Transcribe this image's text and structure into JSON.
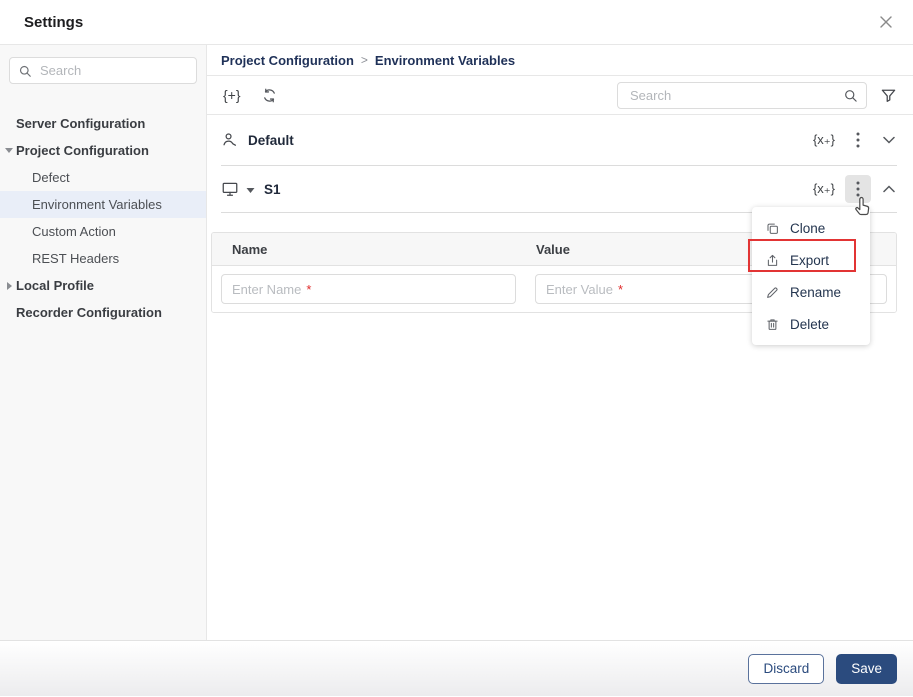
{
  "window": {
    "title": "Settings"
  },
  "sidebar": {
    "search": {
      "placeholder": "Search"
    },
    "items": [
      {
        "label": "Server Configuration"
      },
      {
        "label": "Project Configuration"
      },
      {
        "label": "Defect"
      },
      {
        "label": "Environment Variables"
      },
      {
        "label": "Custom Action"
      },
      {
        "label": "REST Headers"
      },
      {
        "label": "Local Profile"
      },
      {
        "label": "Recorder Configuration"
      }
    ]
  },
  "main": {
    "breadcrumb": {
      "parent": "Project Configuration",
      "separator": ">",
      "current": "Environment Variables"
    },
    "toolbar": {
      "add_glyph": "{+}",
      "search_placeholder": "Search"
    },
    "sections": {
      "default": {
        "label": "Default",
        "add_variable_glyph": "{x₊}"
      },
      "s1": {
        "label": "S1",
        "add_variable_glyph": "{x₊}"
      }
    },
    "table": {
      "columns": [
        "Name",
        "Value"
      ],
      "name_input": {
        "placeholder": "Enter Name",
        "required_mark": "*"
      },
      "value_input": {
        "placeholder": "Enter Value",
        "required_mark": "*"
      }
    },
    "context_menu": {
      "items": [
        {
          "label": "Clone"
        },
        {
          "label": "Export"
        },
        {
          "label": "Rename"
        },
        {
          "label": "Delete"
        }
      ]
    }
  },
  "footer": {
    "discard_label": "Discard",
    "save_label": "Save"
  },
  "colors": {
    "accent_navy": "#2b4b7e",
    "highlight_red": "#e23434",
    "selected_item_bg": "#e9eef8"
  }
}
